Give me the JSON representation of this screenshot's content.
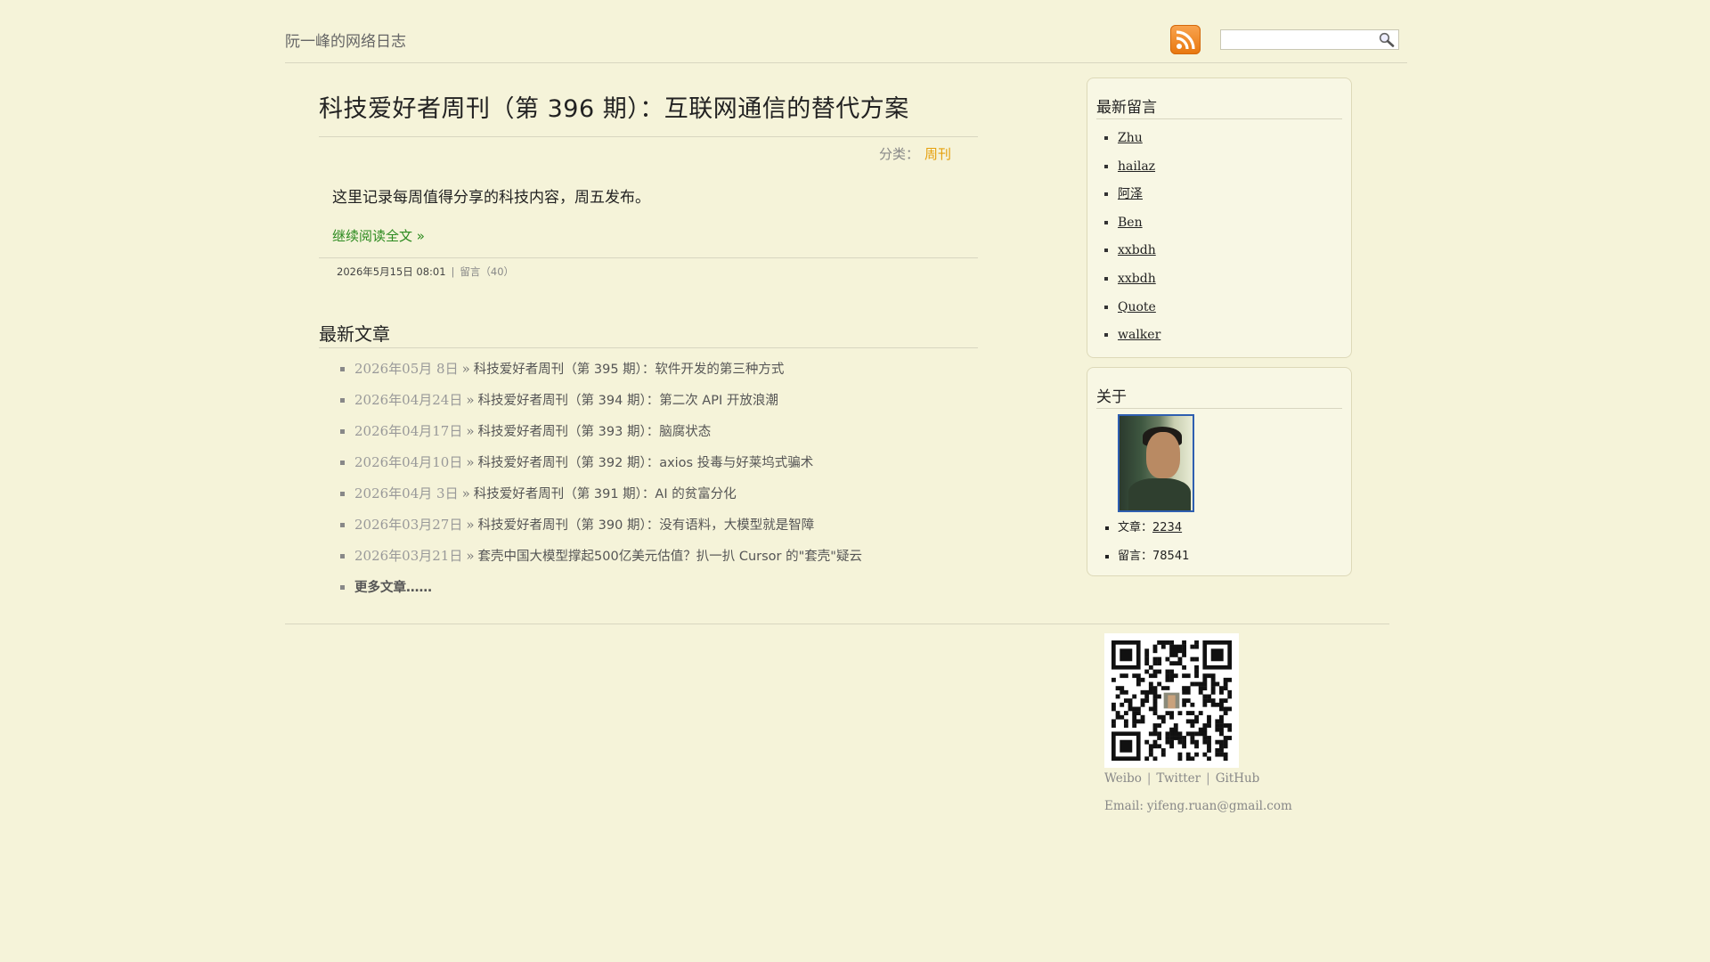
{
  "header": {
    "site_title": "阮一峰的网络日志",
    "search": {
      "value": "",
      "placeholder": ""
    }
  },
  "article": {
    "title": "科技爱好者周刊（第 396 期）：互联网通信的替代方案",
    "category_label": "分类：",
    "category": "周刊",
    "excerpt": "这里记录每周值得分享的科技内容，周五发布。",
    "read_more": "继续阅读全文 »",
    "date": "2026年5月15日 08:01",
    "separator": "|",
    "comments": "留言（40）"
  },
  "recent": {
    "heading": "最新文章",
    "items": [
      {
        "date": "2026年05月 8日",
        "raquo": "»",
        "title": "科技爱好者周刊（第 395 期）：软件开发的第三种方式"
      },
      {
        "date": "2026年04月24日",
        "raquo": "»",
        "title": "科技爱好者周刊（第 394 期）：第二次 API 开放浪潮"
      },
      {
        "date": "2026年04月17日",
        "raquo": "»",
        "title": "科技爱好者周刊（第 393 期）：脑腐状态"
      },
      {
        "date": "2026年04月10日",
        "raquo": "»",
        "title": "科技爱好者周刊（第 392 期）：axios 投毒与好莱坞式骗术"
      },
      {
        "date": "2026年04月 3日",
        "raquo": "»",
        "title": "科技爱好者周刊（第 391 期）：AI 的贫富分化"
      },
      {
        "date": "2026年03月27日",
        "raquo": "»",
        "title": "科技爱好者周刊（第 390 期）：没有语料，大模型就是智障"
      },
      {
        "date": "2026年03月21日",
        "raquo": "»",
        "title": "套壳中国大模型撑起500亿美元估值？扒一扒 Cursor 的\"套壳\"疑云"
      }
    ],
    "more": "更多文章……"
  },
  "sidebar": {
    "comments_heading": "最新留言",
    "commenters": [
      "Zhu",
      "hailaz",
      "阿泽",
      "Ben",
      "xxbdh",
      "xxbdh",
      "Quote",
      "walker"
    ],
    "about_heading": "关于",
    "articles_label": "文章：",
    "articles_count": "2234",
    "comments_label": "留言：",
    "comments_count": "78541"
  },
  "footer": {
    "links": [
      "Weibo",
      "Twitter",
      "GitHub"
    ],
    "separator": "|",
    "email_label": "Email:",
    "email": "yifeng.ruan@gmail.com"
  },
  "colors": {
    "background": "#f5f3d9",
    "category_link": "#e5a00d",
    "read_more": "#2b8a1e",
    "rss": "#f08a24",
    "avatar_border": "#2f5fb0"
  },
  "icons": [
    "rss-icon",
    "search-icon",
    "avatar",
    "qr-code"
  ]
}
